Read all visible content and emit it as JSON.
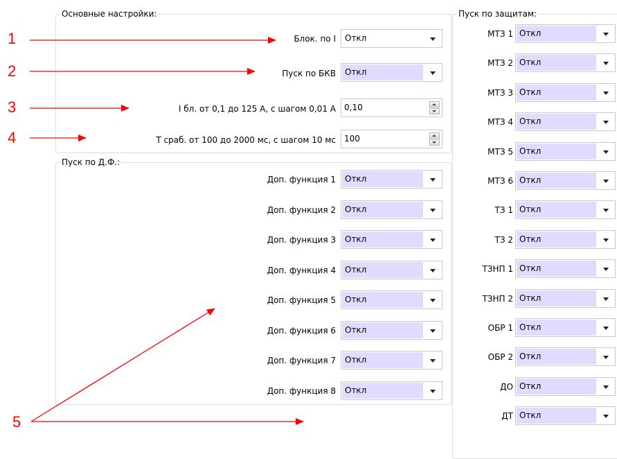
{
  "main_settings": {
    "title": "Основные настройки:",
    "rows": [
      {
        "label": "Блок. по I",
        "value": "Откл"
      },
      {
        "label": "Пуск по БКВ",
        "value": "Откл"
      },
      {
        "label": "I бл. от 0,1 до 125 А, с шагом 0,01 А",
        "value": "0,10"
      },
      {
        "label": "Т сраб. от 100 до 2000 мс, с шагом 10 мс",
        "value": "100"
      }
    ]
  },
  "df_start": {
    "title": "Пуск по Д.Ф.:",
    "rows": [
      {
        "label": "Доп. функция 1",
        "value": "Откл"
      },
      {
        "label": "Доп. функция 2",
        "value": "Откл"
      },
      {
        "label": "Доп. функция 3",
        "value": "Откл"
      },
      {
        "label": "Доп. функция 4",
        "value": "Откл"
      },
      {
        "label": "Доп. функция 5",
        "value": "Откл"
      },
      {
        "label": "Доп. функция 6",
        "value": "Откл"
      },
      {
        "label": "Доп. функция 7",
        "value": "Откл"
      },
      {
        "label": "Доп. функция 8",
        "value": "Откл"
      }
    ]
  },
  "protection_start": {
    "title": "Пуск по защитам:",
    "rows": [
      {
        "label": "МТЗ 1",
        "value": "Откл"
      },
      {
        "label": "МТЗ 2",
        "value": "Откл"
      },
      {
        "label": "МТЗ 3",
        "value": "Откл"
      },
      {
        "label": "МТЗ 4",
        "value": "Откл"
      },
      {
        "label": "МТЗ 5",
        "value": "Откл"
      },
      {
        "label": "МТЗ 6",
        "value": "Откл"
      },
      {
        "label": "ТЗ 1",
        "value": "Откл"
      },
      {
        "label": "ТЗ 2",
        "value": "Откл"
      },
      {
        "label": "ТЗНП 1",
        "value": "Откл"
      },
      {
        "label": "ТЗНП 2",
        "value": "Откл"
      },
      {
        "label": "ОБР 1",
        "value": "Откл"
      },
      {
        "label": "ОБР 2",
        "value": "Откл"
      },
      {
        "label": "ДО",
        "value": "Откл"
      },
      {
        "label": "ДТ",
        "value": "Откл"
      }
    ]
  },
  "annotations": {
    "numbers": [
      "1",
      "2",
      "3",
      "4",
      "5"
    ],
    "color": "#ff0000"
  },
  "colors": {
    "highlight": "#e0dcff",
    "border": "#dcdcdc"
  }
}
